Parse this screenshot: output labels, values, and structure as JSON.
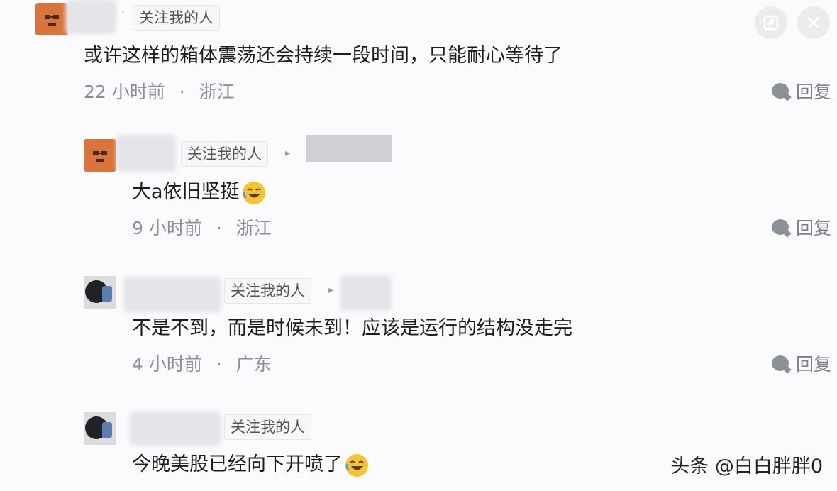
{
  "header_buttons": {
    "share_icon": "share-icon",
    "close_icon": "close-icon"
  },
  "comments": [
    {
      "follow_tag": "关注我的人",
      "content": "或许这样的箱体震荡还会持续一段时间，只能耐心等待了",
      "time": "22 小时前",
      "separator": "·",
      "location": "浙江",
      "reply": "回复"
    },
    {
      "follow_tag": "关注我的人",
      "content": "大a依旧坚挺",
      "time": "9 小时前",
      "separator": "·",
      "location": "浙江",
      "reply": "回复"
    },
    {
      "follow_tag": "关注我的人",
      "content": "不是不到，而是时候未到！应该是运行的结构没走完",
      "time": "4 小时前",
      "separator": "·",
      "location": "广东",
      "reply": "回复"
    },
    {
      "follow_tag": "关注我的人",
      "content": "今晚美股已经向下开喷了"
    }
  ],
  "watermark": "头条 @白白胖胖0",
  "colors": {
    "tag_bg": "#f7f7f9",
    "meta": "#8b8f96",
    "avatar_orange": "#d9743c"
  }
}
